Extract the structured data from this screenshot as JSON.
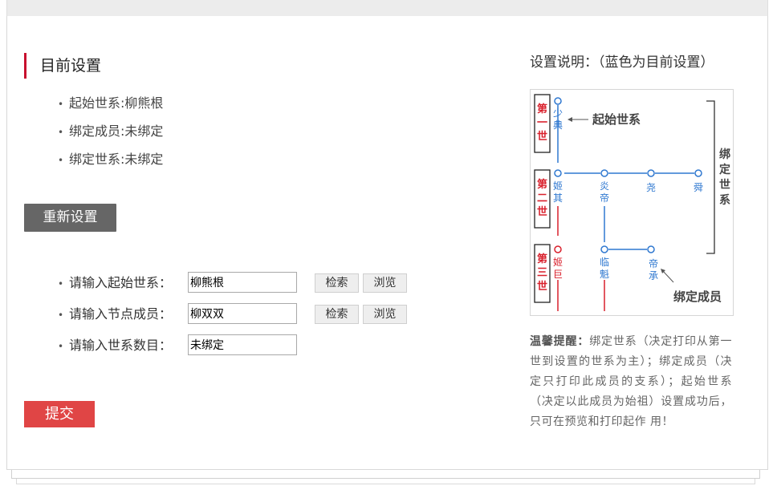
{
  "current": {
    "title": "目前设置",
    "items": [
      "起始世系:柳熊根",
      "绑定成员:未绑定",
      "绑定世系:未绑定"
    ]
  },
  "reset_button": "重新设置",
  "form": {
    "start_label": "请输入起始世系：",
    "start_value": "柳熊根",
    "node_label": "请输入节点成员：",
    "node_value": "柳双双",
    "count_label": "请输入世系数目：",
    "count_value": "未绑定",
    "search_label": "检索",
    "browse_label": "浏览"
  },
  "submit_button": "提交",
  "description": {
    "title": "设置说明：（蓝色为目前设置）",
    "diagram": {
      "gen1": "第一世",
      "gen2": "第二世",
      "gen3": "第三世",
      "start_label": "起始世系",
      "binding_label": "绑定世系",
      "member_label": "绑定成员",
      "names": {
        "shaodian": "少典",
        "jiqi": "姬其",
        "yandi": "炎帝",
        "yao": "尧",
        "shun": "舜",
        "jiju": "姬巨",
        "linkui": "临魁",
        "dicheng": "帝承"
      }
    },
    "tip_label": "温馨提醒：",
    "tip_text": "绑定世系（决定打印从第一世到设置的世系为主）；绑定成员（决定只打印此成员的支系）；起始世系（决定以此成员为始祖）设置成功后，只可在预览和打印起作 用！"
  },
  "colors": {
    "accent": "#c8102e",
    "reset": "#666666",
    "submit": "#e04545",
    "diagram_blue": "#2f78d0",
    "diagram_red": "#d9202c"
  }
}
